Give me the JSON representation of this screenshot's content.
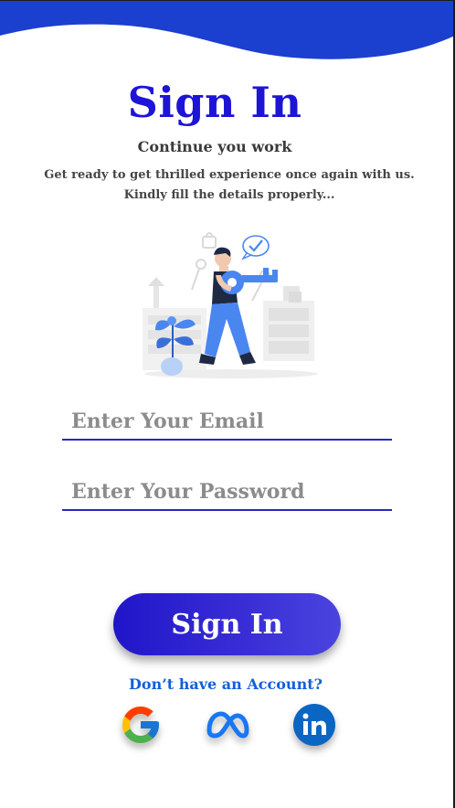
{
  "header": {
    "title": "Sign In",
    "subtitle": "Continue you work",
    "description_line1": "Get ready to get thrilled experience once again with us.",
    "description_line2": "Kindly fill the details properly..."
  },
  "form": {
    "email_placeholder": "Enter Your Email",
    "email_value": "",
    "password_placeholder": "Enter Your Password",
    "password_value": "",
    "submit_label": "Sign In"
  },
  "footer": {
    "signup_prompt": "Don’t have an Account?",
    "social_logins": [
      "google-icon",
      "meta-icon",
      "linkedin-icon"
    ]
  },
  "colors": {
    "accent": "#1d14d6",
    "header_wave": "#1b3fcf",
    "link": "#1160d8",
    "illustration_blue": "#4a86f0"
  }
}
